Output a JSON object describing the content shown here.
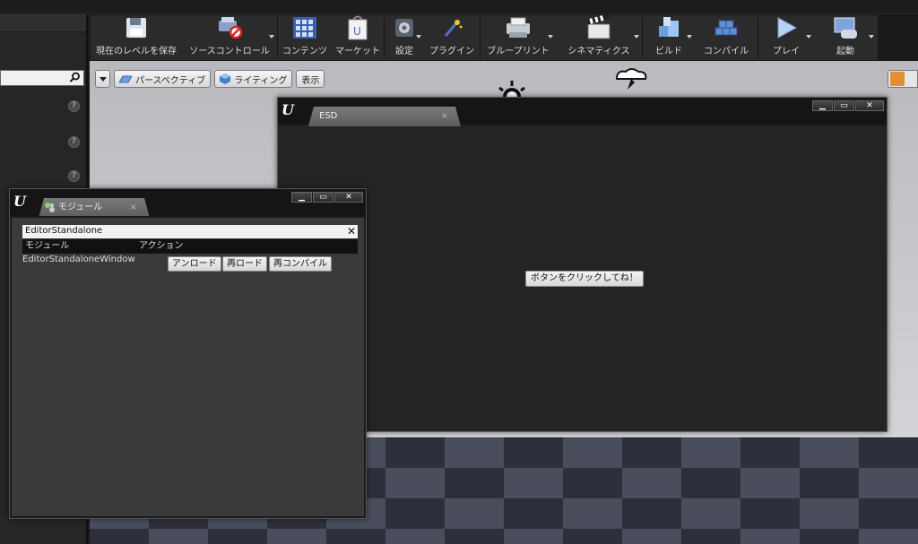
{
  "toolbar": {
    "save_level": "現在のレベルを保存",
    "source_control": "ソースコントロール",
    "content": "コンテンツ",
    "marketplace": "マーケット",
    "settings": "設定",
    "plugins": "プラグイン",
    "blueprints": "ブループリント",
    "cinematics": "シネマティクス",
    "build": "ビルド",
    "compile": "コンパイル",
    "play": "プレイ",
    "launch": "起動"
  },
  "viewport": {
    "perspective": "パースペクティブ",
    "lighting": "ライティング",
    "show": "表示"
  },
  "esd_window": {
    "tab": "ESD",
    "button": "ボタンをクリックしてね！"
  },
  "modules_window": {
    "tab": "モジュール",
    "filter": "EditorStandalone",
    "col_module": "モジュール",
    "col_action": "アクション",
    "rows": [
      {
        "name": "EditorStandaloneWindow",
        "unload": "アンロード",
        "reload": "再ロード",
        "recompile": "再コンパイル"
      }
    ]
  },
  "colors": {
    "accent_orange": "#e09030",
    "window_bg": "#242424"
  }
}
